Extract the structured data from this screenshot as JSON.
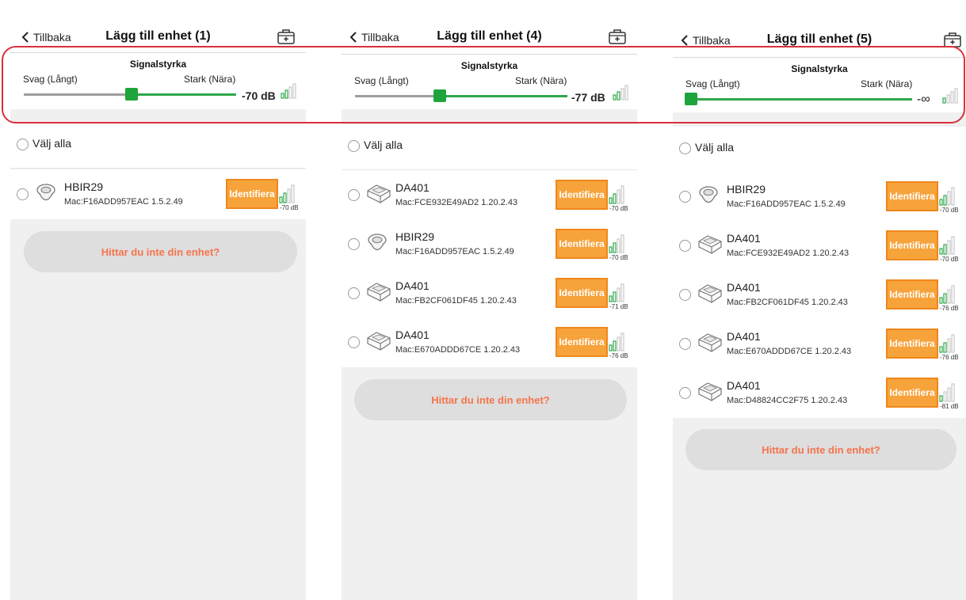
{
  "common": {
    "back_label": "Tillbaka",
    "signal_title": "Signalstyrka",
    "weak_label": "Svag (Långt)",
    "strong_label": "Stark (Nära)",
    "select_all_label": "Välj alla",
    "identify_label": "Identifiera",
    "not_found_label": "Hittar du inte din enhet?"
  },
  "colors": {
    "accent_orange": "#f7a33b",
    "slider_green": "#2ea84a",
    "not_found_text": "#f5744c",
    "highlight_red": "#d9303b"
  },
  "panels": [
    {
      "title": "Lägg till enhet (1)",
      "signal_value": "-70 dB",
      "devices": [
        {
          "name": "HBIR29",
          "mac": "Mac:F16ADD957EAC  1.5.2.49",
          "db": "-70 dB",
          "icon": "sensor-round-icon"
        }
      ]
    },
    {
      "title": "Lägg till enhet (4)",
      "signal_value": "-77 dB",
      "devices": [
        {
          "name": "DA401",
          "mac": "Mac:FCE932E49AD2  1.20.2.43",
          "db": "-70 dB",
          "icon": "detector-box-icon"
        },
        {
          "name": "HBIR29",
          "mac": "Mac:F16ADD957EAC  1.5.2.49",
          "db": "-70 dB",
          "icon": "sensor-round-icon"
        },
        {
          "name": "DA401",
          "mac": "Mac:FB2CF061DF45  1.20.2.43",
          "db": "-71 dB",
          "icon": "detector-box-icon"
        },
        {
          "name": "DA401",
          "mac": "Mac:E670ADDD67CE  1.20.2.43",
          "db": "-76 dB",
          "icon": "detector-box-icon"
        }
      ]
    },
    {
      "title": "Lägg till enhet (5)",
      "signal_value": "-∞",
      "devices": [
        {
          "name": "HBIR29",
          "mac": "Mac:F16ADD957EAC  1.5.2.49",
          "db": "-70 dB",
          "icon": "sensor-round-icon"
        },
        {
          "name": "DA401",
          "mac": "Mac:FCE932E49AD2  1.20.2.43",
          "db": "-70 dB",
          "icon": "detector-box-icon"
        },
        {
          "name": "DA401",
          "mac": "Mac:FB2CF061DF45  1.20.2.43",
          "db": "-76 dB",
          "icon": "detector-box-icon"
        },
        {
          "name": "DA401",
          "mac": "Mac:E670ADDD67CE  1.20.2.43",
          "db": "-76 dB",
          "icon": "detector-box-icon"
        },
        {
          "name": "DA401",
          "mac": "Mac:D48824CC2F75  1.20.2.43",
          "db": "-81 dB",
          "icon": "detector-box-icon"
        }
      ]
    }
  ]
}
